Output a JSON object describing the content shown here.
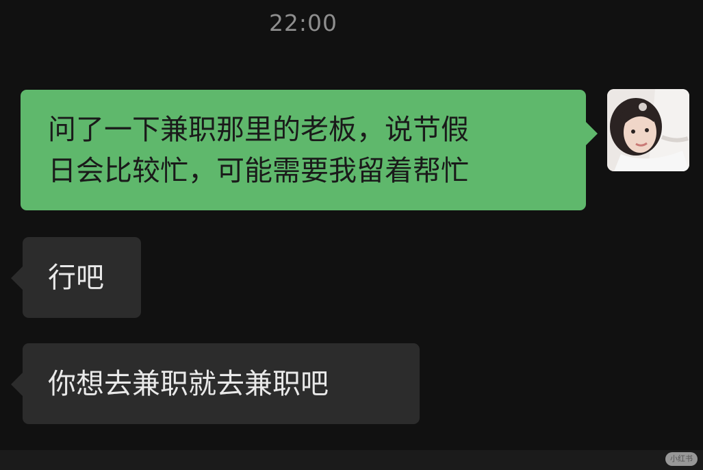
{
  "chat": {
    "timestamp": "22:00",
    "messages": [
      {
        "direction": "outgoing",
        "lines": [
          "问了一下兼职那里的老板，说节假",
          "日会比较忙，可能需要我留着帮忙"
        ]
      },
      {
        "direction": "incoming",
        "text": "行吧"
      },
      {
        "direction": "incoming",
        "text": "你想去兼职就去兼职吧"
      }
    ]
  },
  "theme": {
    "background": "#111111",
    "outgoing_bubble": "#5fb86c",
    "incoming_bubble": "#2c2c2c"
  },
  "icons": {
    "avatar": "user-avatar-photo",
    "watermark": "app-watermark"
  },
  "watermark": {
    "text": "小红书"
  }
}
